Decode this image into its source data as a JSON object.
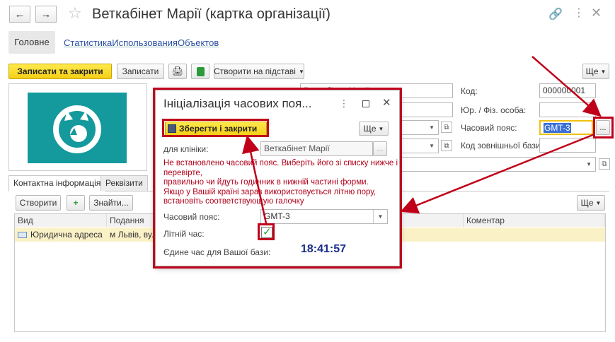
{
  "window": {
    "title": "Веткабінет Марії (картка організації)"
  },
  "nav": {
    "main_tab": "Головне",
    "stats_link": "СтатистикаИспользованияОбъектов"
  },
  "toolbar": {
    "save_close": "Записати та закрити",
    "save": "Записати",
    "create_based": "Створити на підставі",
    "more": "Ще"
  },
  "form": {
    "code_label": "Код:",
    "code_value": "000000001",
    "legal_label": "Юр. / Фіз. особа:",
    "timezone_label": "Часовий пояс:",
    "timezone_value": "GMT-3",
    "extcode_label": "Код зовнішньої бази:",
    "name_value": "Веткабінет Марії"
  },
  "tabs": [
    "Контактна інформація",
    "Реквізити"
  ],
  "subtoolbar": {
    "create": "Створити",
    "find": "Знайти...",
    "more": "Ще"
  },
  "table": {
    "headers": [
      "Вид",
      "Подання",
      "Коментар"
    ],
    "rows": [
      {
        "kind": "Юридична адреса",
        "view": "м Львів, вул",
        "comment": ""
      }
    ]
  },
  "dialog": {
    "title": "Ініціалізація часових поя...",
    "save_close": "Зберегти і закрити",
    "more": "Ще",
    "clinic_label": "для клініки:",
    "clinic_value": "Веткабінет Марії",
    "warning": [
      "Не встановлено часовий пояс. Виберіть його зі списку нижче і",
      "перевірте,",
      "правильно чи йдуть годинник в нижній частині форми.",
      "Якщо у Вашій країні зараз використовується літню пору,",
      "встановіть соответствующую галочку"
    ],
    "tz_label": "Часовий пояс:",
    "tz_value": "GMT-3",
    "summer_label": "Літній час:",
    "summer_checked": true,
    "time_label": "Єдине час для Вашої бази:",
    "time_value": "18:41:57"
  },
  "colors": {
    "accent_yellow": "#f4cf15",
    "annotation_red": "#c0001a",
    "logo_teal": "#14999c",
    "clock_blue": "#1a2e8a"
  }
}
